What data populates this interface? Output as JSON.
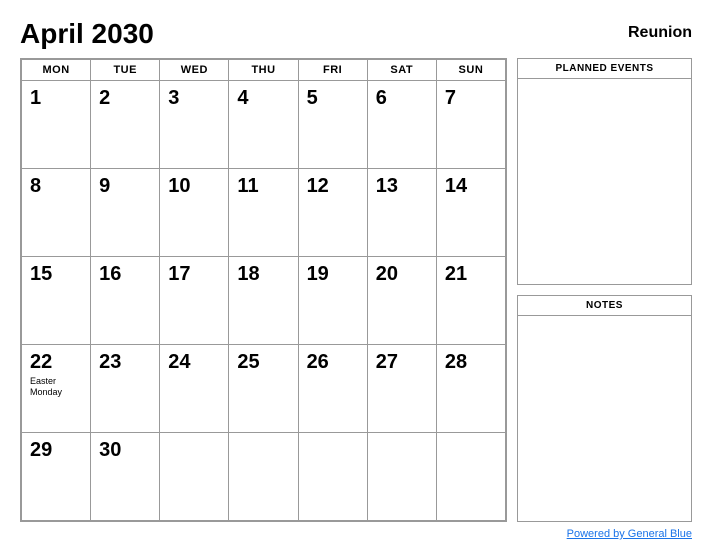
{
  "header": {
    "title": "April 2030",
    "region": "Reunion"
  },
  "calendar": {
    "days_of_week": [
      "MON",
      "TUE",
      "WED",
      "THU",
      "FRI",
      "SAT",
      "SUN"
    ],
    "weeks": [
      [
        {
          "day": "1",
          "event": ""
        },
        {
          "day": "2",
          "event": ""
        },
        {
          "day": "3",
          "event": ""
        },
        {
          "day": "4",
          "event": ""
        },
        {
          "day": "5",
          "event": ""
        },
        {
          "day": "6",
          "event": ""
        },
        {
          "day": "7",
          "event": ""
        }
      ],
      [
        {
          "day": "8",
          "event": ""
        },
        {
          "day": "9",
          "event": ""
        },
        {
          "day": "10",
          "event": ""
        },
        {
          "day": "11",
          "event": ""
        },
        {
          "day": "12",
          "event": ""
        },
        {
          "day": "13",
          "event": ""
        },
        {
          "day": "14",
          "event": ""
        }
      ],
      [
        {
          "day": "15",
          "event": ""
        },
        {
          "day": "16",
          "event": ""
        },
        {
          "day": "17",
          "event": ""
        },
        {
          "day": "18",
          "event": ""
        },
        {
          "day": "19",
          "event": ""
        },
        {
          "day": "20",
          "event": ""
        },
        {
          "day": "21",
          "event": ""
        }
      ],
      [
        {
          "day": "22",
          "event": "Easter Monday"
        },
        {
          "day": "23",
          "event": ""
        },
        {
          "day": "24",
          "event": ""
        },
        {
          "day": "25",
          "event": ""
        },
        {
          "day": "26",
          "event": ""
        },
        {
          "day": "27",
          "event": ""
        },
        {
          "day": "28",
          "event": ""
        }
      ],
      [
        {
          "day": "29",
          "event": ""
        },
        {
          "day": "30",
          "event": ""
        },
        {
          "day": "",
          "event": ""
        },
        {
          "day": "",
          "event": ""
        },
        {
          "day": "",
          "event": ""
        },
        {
          "day": "",
          "event": ""
        },
        {
          "day": "",
          "event": ""
        }
      ]
    ]
  },
  "sidebar": {
    "planned_events_title": "PLANNED EVENTS",
    "notes_title": "NOTES"
  },
  "footer": {
    "link_text": "Powered by General Blue",
    "link_url": "#"
  }
}
